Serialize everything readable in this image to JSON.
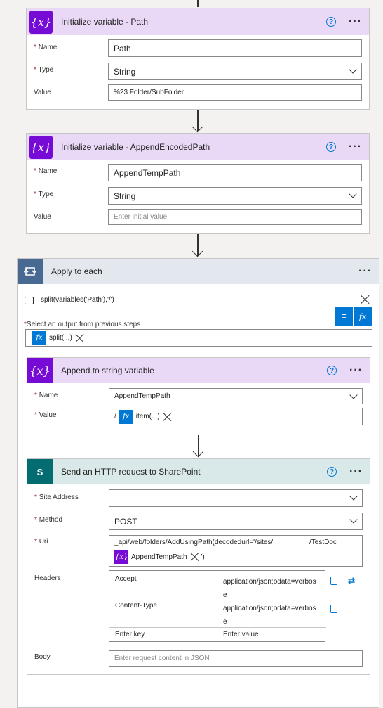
{
  "init_path": {
    "title": "Initialize variable - Path",
    "icon": "variable-icon",
    "name_label": "Name",
    "name_value": "Path",
    "type_label": "Type",
    "type_value": "String",
    "value_label": "Value",
    "value_value": "%23 Folder/SubFolder"
  },
  "init_append": {
    "title": "Initialize variable - AppendEncodedPath",
    "name_label": "Name",
    "name_value": "AppendTempPath",
    "type_label": "Type",
    "type_value": "String",
    "value_label": "Value",
    "value_placeholder": "Enter initial value"
  },
  "apply_each": {
    "title": "Apply to each",
    "expression": "split(variables('Path'),'/')",
    "select_label": "Select an output from previous steps",
    "token_label": "split(...)"
  },
  "append_var": {
    "title": "Append to string variable",
    "name_label": "Name",
    "name_value": "AppendTempPath",
    "value_label": "Value",
    "value_prefix": "/",
    "token_label": "item(...)"
  },
  "http_sp": {
    "title": "Send an HTTP request to SharePoint",
    "site_label": "Site Address",
    "site_value": "",
    "method_label": "Method",
    "method_value": "POST",
    "uri_label": "Uri",
    "uri_line1": "_api/web/folders/AddUsingPath(decodedurl='/sites/",
    "uri_line1_end": "/TestDoc",
    "uri_token": "AppendTempPath",
    "uri_suffix": "')",
    "headers_label": "Headers",
    "headers": [
      {
        "key": "Accept",
        "value_line1": "application/json;odata=verbos",
        "value_line2": "e"
      },
      {
        "key": "Content-Type",
        "value_line1": "application/json;odata=verbos",
        "value_line2": "e"
      }
    ],
    "key_placeholder": "Enter key",
    "value_placeholder": "Enter value",
    "body_label": "Body",
    "body_placeholder": "Enter request content in JSON"
  },
  "colors": {
    "variable_purple": "#770bd6",
    "variable_header": "#e9d9f6",
    "loop_blue": "#486991",
    "loop_header": "#e3e8ef",
    "sharepoint_teal": "#036c70",
    "sharepoint_header": "#d9e9e9",
    "expression_blue": "#0078d4"
  }
}
